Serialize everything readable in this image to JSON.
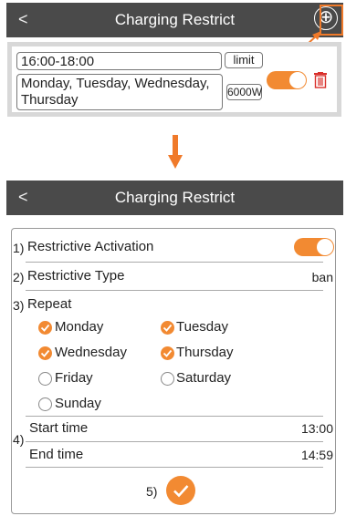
{
  "screen1": {
    "header": {
      "back": "<",
      "title": "Charging Restrict",
      "add": "⊕"
    },
    "rule": {
      "time": "16:00-18:00",
      "mode": "limit",
      "days": "Monday, Tuesday, Wednesday, Thursday",
      "power": "6000W",
      "enabled": true
    }
  },
  "screen2": {
    "header": {
      "back": "<",
      "title": "Charging Restrict"
    },
    "activation": {
      "num": "1)",
      "label": "Restrictive Activation",
      "enabled": true
    },
    "type": {
      "num": "2)",
      "label": "Restrictive Type",
      "value": "ban"
    },
    "repeat": {
      "num": "3)",
      "label": "Repeat",
      "days": [
        {
          "label": "Monday",
          "checked": true
        },
        {
          "label": "Tuesday",
          "checked": true
        },
        {
          "label": "Wednesday",
          "checked": true
        },
        {
          "label": "Thursday",
          "checked": true
        },
        {
          "label": "Friday",
          "checked": false
        },
        {
          "label": "Saturday",
          "checked": false
        },
        {
          "label": "Sunday",
          "checked": false
        }
      ]
    },
    "time": {
      "num": "4)",
      "start_label": "Start time",
      "start_value": "13:00",
      "end_label": "End time",
      "end_value": "14:59"
    },
    "confirm": {
      "num": "5)"
    }
  },
  "colors": {
    "accent": "#f28a32",
    "header_bg": "#4a4a4a",
    "highlight": "#f07a2a",
    "trash": "#d9302c"
  }
}
